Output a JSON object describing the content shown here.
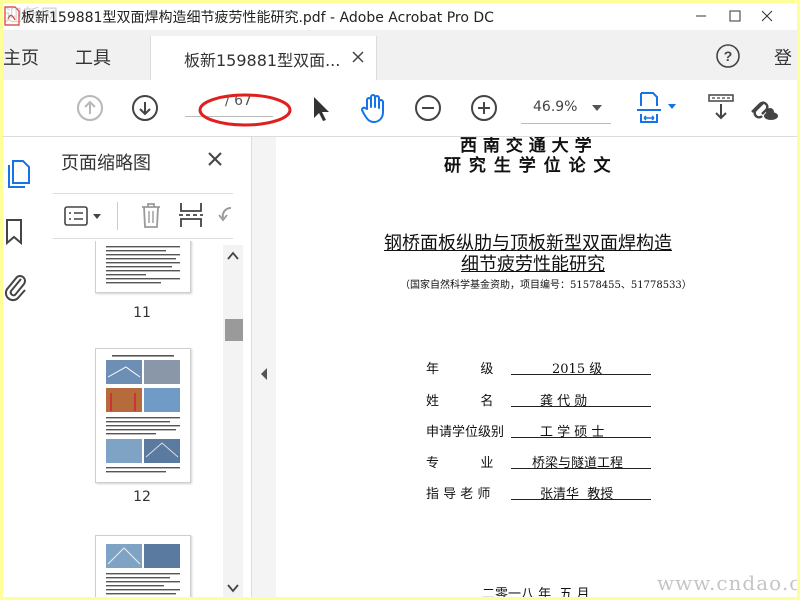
{
  "window": {
    "title": "板新159881型双面焊构造细节疲劳性能研究.pdf - Adobe Acrobat Pro DC",
    "watermark_top": "迎新网",
    "watermark_bottom": "www.cndao.com"
  },
  "tabs": {
    "home": "主页",
    "tools": "工具",
    "document_tab": "板新159881型双面...",
    "login": "登"
  },
  "toolbar": {
    "page_total": "/ 67",
    "zoom": "46.9%"
  },
  "thumbnails": {
    "title": "页面缩略图",
    "pages": [
      {
        "number": "11"
      },
      {
        "number": "12"
      }
    ]
  },
  "document": {
    "university": "西 南 交 通 大 学",
    "thesis_type": "研 究 生 学 位 论 文",
    "title_line1": "钢桥面板纵肋与顶板新型双面焊构造",
    "title_line2": "细节疲劳性能研究",
    "funding": "（国家自然科学基金资助，项目编号：51578455、51778533）",
    "fields": [
      {
        "label": "年          级",
        "value": "2015 级"
      },
      {
        "label": "姓          名",
        "value": "龚 代 勋"
      },
      {
        "label": "申请学位级别",
        "value": "工 学 硕 士"
      },
      {
        "label": "专          业",
        "value": "桥梁与隧道工程"
      },
      {
        "label": "指 导 老 师",
        "value": "张清华  教授"
      }
    ],
    "date": "二零一八 年  五 月"
  },
  "colors": {
    "accent_blue": "#1473e6",
    "annotation_red": "#e02020",
    "border_yellow": "#ffff99"
  }
}
